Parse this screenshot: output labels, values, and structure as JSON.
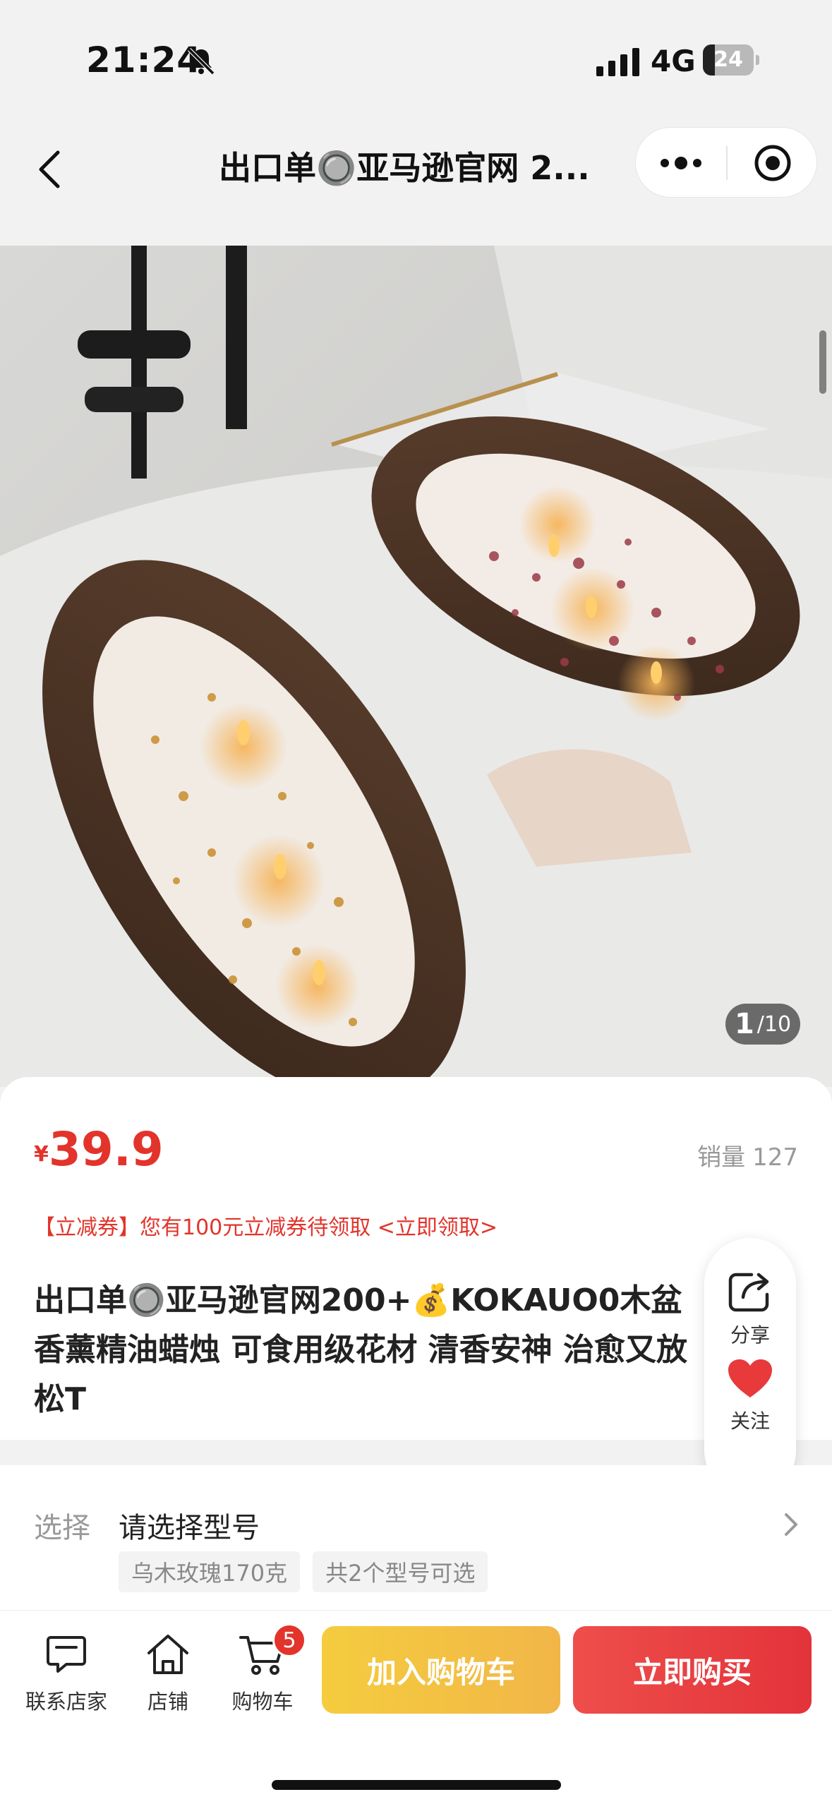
{
  "status_bar": {
    "time": "21:24",
    "network": "4G",
    "battery_level": "24",
    "battery_fraction": 0.24,
    "icons": [
      "bell-off-icon",
      "signal-icon",
      "battery-icon"
    ]
  },
  "nav": {
    "title": "出口单🔘亚马逊官网 2...",
    "icons": [
      "back-arrow-icon",
      "more-dots-icon",
      "close-target-icon"
    ]
  },
  "gallery": {
    "current": "1",
    "total": "/10"
  },
  "product": {
    "currency": "¥",
    "price": "39.9",
    "sales_label": "销量",
    "sales_count": "127",
    "coupon_text": "【立减券】您有100元立减券待领取 <立即领取>",
    "title": "出口单🔘亚马逊官网200+💰KOKAUO0木盆香薰精油蜡烛 可食用级花材 清香安神 治愈又放松T"
  },
  "float_actions": {
    "share_label": "分享",
    "follow_label": "关注"
  },
  "spec": {
    "label": "选择",
    "value": "请选择型号",
    "tags": [
      "乌木玫瑰170克",
      "共2个型号可选"
    ]
  },
  "bottom_bar": {
    "contact_label": "联系店家",
    "store_label": "店铺",
    "cart_label": "购物车",
    "cart_count": "5",
    "add_to_cart": "加入购物车",
    "buy_now": "立即购买"
  },
  "colors": {
    "price_red": "#e2342b",
    "add_cart_yellow": "#f2c23f",
    "buy_now_red": "#e83b3f"
  }
}
